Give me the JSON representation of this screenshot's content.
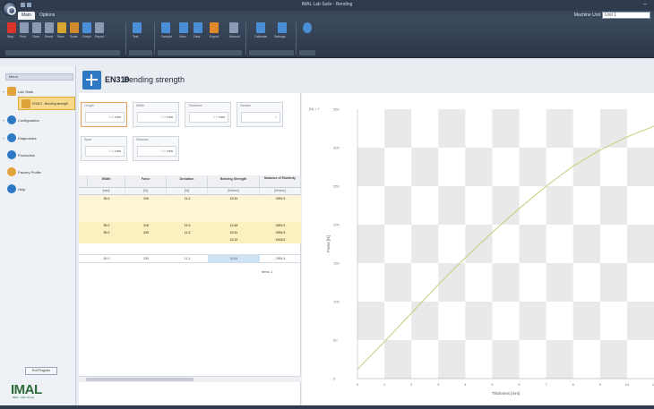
{
  "window": {
    "title": "IMAL Lab Suite - Bending"
  },
  "tabs": [
    {
      "label": "Main"
    },
    {
      "label": "Options"
    }
  ],
  "instance": {
    "label": "Machine Unit",
    "value": "Unit 1"
  },
  "ribbon": {
    "buttons": [
      {
        "label": "Stop",
        "color": "#d9352a"
      },
      {
        "label": "Print",
        "color": "#8b9bb3"
      },
      {
        "label": "Clear",
        "color": "#8b9bb3"
      },
      {
        "label": "Reset",
        "color": "#8b9bb3"
      },
      {
        "label": "Save",
        "color": "#d9a531"
      },
      {
        "label": "Scale",
        "color": "#d08a2e"
      },
      {
        "label": "Graph",
        "color": "#4a8fd6"
      },
      {
        "label": "Report",
        "color": "#8b9bb3"
      },
      {
        "label": "Test",
        "color": "#4a8fd6"
      },
      {
        "label": "Sample",
        "color": "#4a8fd6"
      },
      {
        "label": "View",
        "color": "#4a8fd6"
      },
      {
        "label": "Data",
        "color": "#4a8fd6"
      },
      {
        "label": "Export",
        "color": "#e28a2b"
      },
      {
        "label": "Manual",
        "color": "#8b9bb3"
      },
      {
        "label": "Calibrate",
        "color": "#4a8fd6"
      },
      {
        "label": "Settings",
        "color": "#4a8fd6"
      }
    ]
  },
  "sidebar": {
    "header": "Menu",
    "items": [
      {
        "label": "Lab Tests",
        "color": "#e0a23a",
        "expand": "+"
      },
      {
        "label": "EN310 - Bending strength",
        "color": "#e0a23a",
        "expand": ""
      },
      {
        "label": "Configuration",
        "color": "#2f78c4",
        "expand": "+"
      },
      {
        "label": "Diagnostics",
        "color": "#2f78c4",
        "expand": "+"
      },
      {
        "label": "Production",
        "color": "#2f78c4",
        "expand": ""
      },
      {
        "label": "Factory Profile",
        "color": "#e0a23a",
        "expand": ""
      },
      {
        "label": "Help",
        "color": "#2f78c4",
        "expand": ""
      }
    ],
    "button": "Exit Program",
    "logo": "IMAL",
    "logo_sub": "IMAL - PAL Group"
  },
  "header": {
    "code": "EN310",
    "title": "Bending strength"
  },
  "params": [
    {
      "label": "Length",
      "value": "0.0",
      "unit": "mm"
    },
    {
      "label": "Width",
      "value": "0.0",
      "unit": "mm"
    },
    {
      "label": "Thickness",
      "value": "0.0",
      "unit": "mm"
    },
    {
      "label": "Sample",
      "value": "1",
      "unit": ""
    },
    {
      "label": "Span",
      "value": "0.0",
      "unit": "mm"
    },
    {
      "label": "Distance",
      "value": "0.0",
      "unit": "mm"
    }
  ],
  "table": {
    "headers": [
      "Width",
      "Force",
      "Deviation",
      "Bending Strength",
      "Modulus of Elasticity"
    ],
    "units": [
      "[mm]",
      "[N]",
      "[%]",
      "[N/mm²]",
      "[N/mm²]"
    ],
    "rows": [
      [
        "50.0",
        "339",
        "11.3",
        "15.81",
        "2954.9"
      ],
      [
        "",
        "",
        "",
        "",
        ""
      ],
      [
        "",
        "",
        "",
        "",
        ""
      ],
      [
        "50.0",
        "318",
        "10.9",
        "14.83",
        "2881.0"
      ],
      [
        "50.0",
        "339",
        "11.3",
        "15.81",
        "2954.9"
      ],
      [
        "",
        "",
        "",
        "15.32",
        "2918.0"
      ]
    ],
    "summary": [
      "50.0",
      "339",
      "11.3",
      "15.81",
      "2954.9"
    ],
    "footer": "Items: 1"
  },
  "chart_data": {
    "type": "line",
    "title": "",
    "xlabel": "Thickness [mm]",
    "ylabel": "Force [N]",
    "corner_label": "[N] = f",
    "xlim": [
      0,
      11
    ],
    "ylim": [
      0,
      350
    ],
    "xticks": [
      0,
      1,
      2,
      3,
      4,
      5,
      6,
      7,
      8,
      9,
      10,
      11
    ],
    "yticks": [
      0,
      50,
      100,
      150,
      200,
      250,
      300,
      350
    ],
    "grid": true,
    "series": [
      {
        "color": "#c8cc7a",
        "x": [
          0,
          1,
          2,
          3,
          4,
          5,
          6,
          7,
          8,
          9,
          10,
          11
        ],
        "y": [
          12,
          48,
          85,
          122,
          157,
          190,
          221,
          250,
          276,
          297,
          314,
          328
        ]
      }
    ]
  }
}
